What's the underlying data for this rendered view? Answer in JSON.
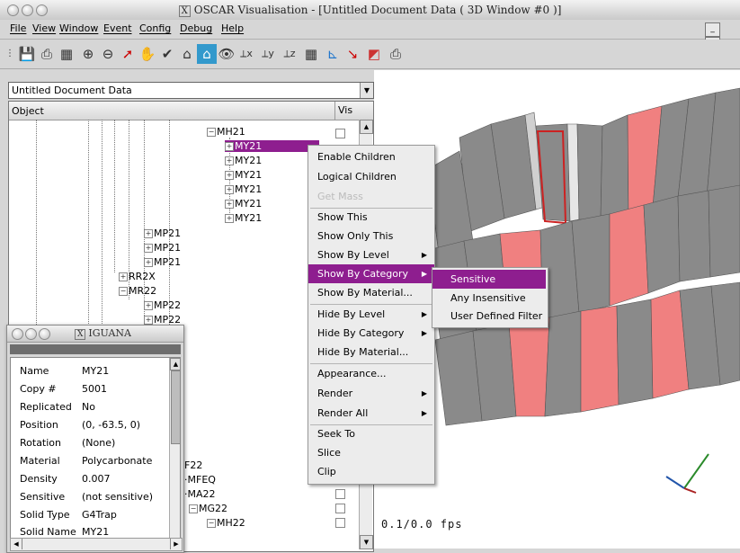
{
  "window": {
    "title": "OSCAR Visualisation - [Untitled Document Data ( 3D Window #0 )]",
    "title_icon": "X"
  },
  "menu": [
    "File",
    "View",
    "Window",
    "Event",
    "Config",
    "Debug",
    "Help"
  ],
  "mdi_buttons": [
    "_",
    "̈"
  ],
  "document_combo": {
    "value": "Untitled Document Data"
  },
  "tree": {
    "header_object": "Object",
    "header_vis": "Vis",
    "nodes": [
      "MH21",
      "MY21",
      "MY21",
      "MY21",
      "MY21",
      "MY21",
      "MY21",
      "MP21",
      "MP21",
      "MP21",
      "RR2X",
      "MR22",
      "MP22",
      "MP22",
      "MFEQ",
      "MA22",
      "MG22",
      "MH22"
    ],
    "partial": [
      "F22"
    ]
  },
  "context_menu": {
    "items": [
      "Enable Children",
      "Logical Children",
      "Get Mass",
      "Show This",
      "Show Only This",
      "Show By Level",
      "Show By Category",
      "Show By Material...",
      "Hide By Level",
      "Hide By Category",
      "Hide By Material...",
      "Appearance...",
      "Render",
      "Render All",
      "Seek To",
      "Slice",
      "Clip"
    ],
    "selected": "Show By Category",
    "disabled": "Get Mass"
  },
  "submenu": {
    "items": [
      "Sensitive",
      "Any Insensitive",
      "User Defined Filter"
    ],
    "selected": "Sensitive"
  },
  "view3d": {
    "fps": "0.1/0.0 fps"
  },
  "iguana": {
    "title": "IGUANA",
    "properties": [
      {
        "name": "Name",
        "value": "MY21"
      },
      {
        "name": "Copy #",
        "value": "5001"
      },
      {
        "name": "Replicated",
        "value": "No"
      },
      {
        "name": "Position",
        "value": "(0, -63.5, 0)"
      },
      {
        "name": "Rotation",
        "value": "(None)"
      },
      {
        "name": "Material",
        "value": "Polycarbonate"
      },
      {
        "name": "Density",
        "value": "0.007"
      },
      {
        "name": "Sensitive",
        "value": "(not sensitive)"
      },
      {
        "name": "Solid Type",
        "value": "G4Trap"
      },
      {
        "name": "Solid Name",
        "value": "MY21"
      }
    ]
  },
  "colors": {
    "selection": "#8e1e8f",
    "sensitive_fill": "#f08080",
    "insensitive_fill": "#8a8a8a"
  }
}
